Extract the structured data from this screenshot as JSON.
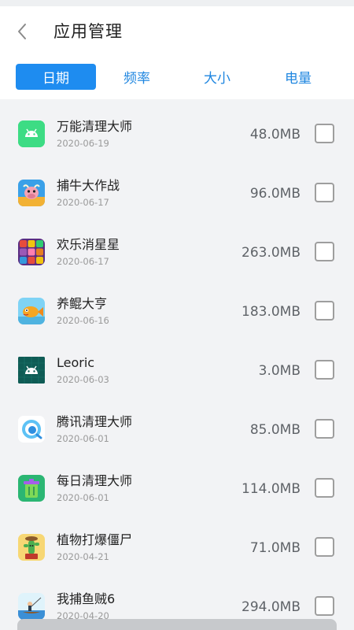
{
  "header": {
    "title": "应用管理"
  },
  "tabs": [
    {
      "label": "日期"
    },
    {
      "label": "频率"
    },
    {
      "label": "大小"
    },
    {
      "label": "电量"
    }
  ],
  "apps": [
    {
      "name": "万能清理大师",
      "date": "2020-06-19",
      "size": "48.0MB",
      "icon": "android-icon"
    },
    {
      "name": "捕牛大作战",
      "date": "2020-06-17",
      "size": "96.0MB",
      "icon": "bull-game-icon"
    },
    {
      "name": "欢乐消星星",
      "date": "2020-06-17",
      "size": "263.0MB",
      "icon": "star-blocks-icon"
    },
    {
      "name": "养鲲大亨",
      "date": "2020-06-16",
      "size": "183.0MB",
      "icon": "fish-icon"
    },
    {
      "name": "Leoric",
      "date": "2020-06-03",
      "size": "3.0MB",
      "icon": "android-icon"
    },
    {
      "name": "腾讯清理大师",
      "date": "2020-06-01",
      "size": "85.0MB",
      "icon": "tencent-clean-icon"
    },
    {
      "name": "每日清理大师",
      "date": "2020-06-01",
      "size": "114.0MB",
      "icon": "trash-bin-icon"
    },
    {
      "name": "植物打爆僵尸",
      "date": "2020-04-21",
      "size": "71.0MB",
      "icon": "plant-cactus-icon"
    },
    {
      "name": "我捕鱼贼6",
      "date": "2020-04-20",
      "size": "294.0MB",
      "icon": "fishing-icon"
    }
  ],
  "colors": {
    "accent": "#1e8cf0",
    "tab_text": "#1f86e0",
    "background": "#f2f3f5"
  }
}
